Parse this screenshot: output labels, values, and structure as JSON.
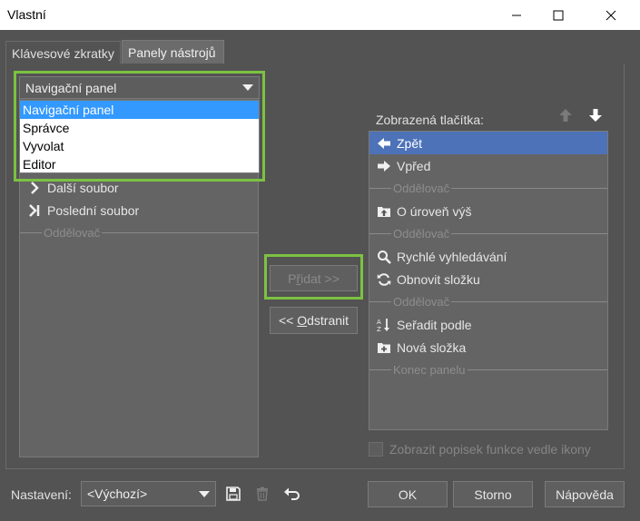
{
  "window": {
    "title": "Vlastní"
  },
  "tabs": [
    {
      "label": "Klávesové zkratky"
    },
    {
      "label": "Panely nástrojů"
    }
  ],
  "toolbar_combo": {
    "value": "Navigační panel",
    "options": [
      "Navigační panel",
      "Správce",
      "Vyvolat",
      "Editor"
    ],
    "highlighted_index": 0
  },
  "available_list": {
    "items": [
      {
        "type": "item",
        "icon": "chevron-right-icon",
        "label": "Další soubor"
      },
      {
        "type": "item",
        "icon": "skip-to-end-icon",
        "label": "Poslední soubor"
      },
      {
        "type": "separator",
        "label": "Oddělovač"
      }
    ]
  },
  "buttons": {
    "add": {
      "prefix": "P",
      "underlined": "ř",
      "rest": "idat >>"
    },
    "remove": {
      "prefix": "<< ",
      "underlined": "O",
      "rest": "dstranit"
    },
    "ok": "OK",
    "cancel": "Storno",
    "help": "Nápověda"
  },
  "shown_list": {
    "label": "Zobrazená tlačítka:",
    "items": [
      {
        "type": "item",
        "icon": "arrow-left-icon",
        "label": "Zpět",
        "selected": true
      },
      {
        "type": "item",
        "icon": "arrow-right-icon",
        "label": "Vpřed"
      },
      {
        "type": "separator",
        "label": "Oddělovač"
      },
      {
        "type": "item",
        "icon": "folder-up-icon",
        "label": "O úroveň výš"
      },
      {
        "type": "separator",
        "label": "Oddělovač"
      },
      {
        "type": "item",
        "icon": "search-icon",
        "label": "Rychlé vyhledávání"
      },
      {
        "type": "item",
        "icon": "refresh-icon",
        "label": "Obnovit složku"
      },
      {
        "type": "separator",
        "label": "Oddělovač"
      },
      {
        "type": "item",
        "icon": "sort-az-icon",
        "label": "Seřadit podle"
      },
      {
        "type": "item",
        "icon": "new-folder-icon",
        "label": "Nová složka"
      },
      {
        "type": "separator",
        "label": "Konec panelu"
      }
    ]
  },
  "show_tooltip_checkbox": {
    "label": "Zobrazit popisek funkce vedle ikony",
    "checked": false,
    "enabled": false
  },
  "settings": {
    "label": "Nastavení:",
    "value": "<Výchozí>"
  }
}
